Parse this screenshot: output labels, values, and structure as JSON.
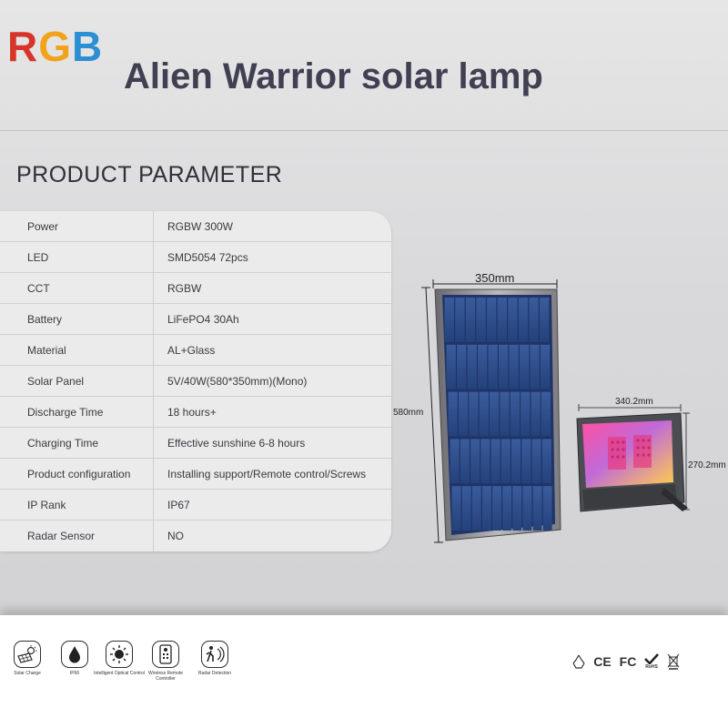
{
  "header": {
    "logo": {
      "r": "R",
      "g": "G",
      "b": "B"
    },
    "title": "Alien Warrior solar lamp"
  },
  "section_title": "PRODUCT PARAMETER",
  "params": [
    {
      "name": "Power",
      "value": "RGBW 300W"
    },
    {
      "name": "LED",
      "value": "SMD5054 72pcs"
    },
    {
      "name": "CCT",
      "value": "RGBW"
    },
    {
      "name": "Battery",
      "value": "LiFePO4 30Ah"
    },
    {
      "name": "Material",
      "value": "AL+Glass"
    },
    {
      "name": "Solar Panel",
      "value": "5V/40W(580*350mm)(Mono)"
    },
    {
      "name": "Discharge Time",
      "value": "18 hours+"
    },
    {
      "name": "Charging Time",
      "value": "Effective sunshine 6-8 hours"
    },
    {
      "name": "Product configuration",
      "value": "Installing support/Remote control/Screws"
    },
    {
      "name": "IP Rank",
      "value": "IP67"
    },
    {
      "name": "Radar Sensor",
      "value": "NO"
    }
  ],
  "dimensions": {
    "panel_width": "350mm",
    "panel_height": "580mm",
    "lamp_width": "340.2mm",
    "lamp_height": "270.2mm"
  },
  "features": [
    {
      "icon": "solar-charge-icon",
      "label": "Solar Charge"
    },
    {
      "icon": "ip66-drop-icon",
      "label": "IP66"
    },
    {
      "icon": "optical-control-icon",
      "label": "Intelligent Optical Control"
    },
    {
      "icon": "remote-controller-icon",
      "label": "Wireless Remote Controller"
    },
    {
      "icon": "radar-detection-icon",
      "label": "Radar Detection"
    }
  ],
  "certifications": [
    "recycle-icon",
    "CE",
    "FC",
    "RoHS",
    "weee-bin-icon"
  ],
  "colors": {
    "logo_r": "#d8352a",
    "logo_g": "#f2a31b",
    "logo_b": "#2d8fd3",
    "title": "#414052",
    "panel_cell": "#2f4f8c"
  }
}
